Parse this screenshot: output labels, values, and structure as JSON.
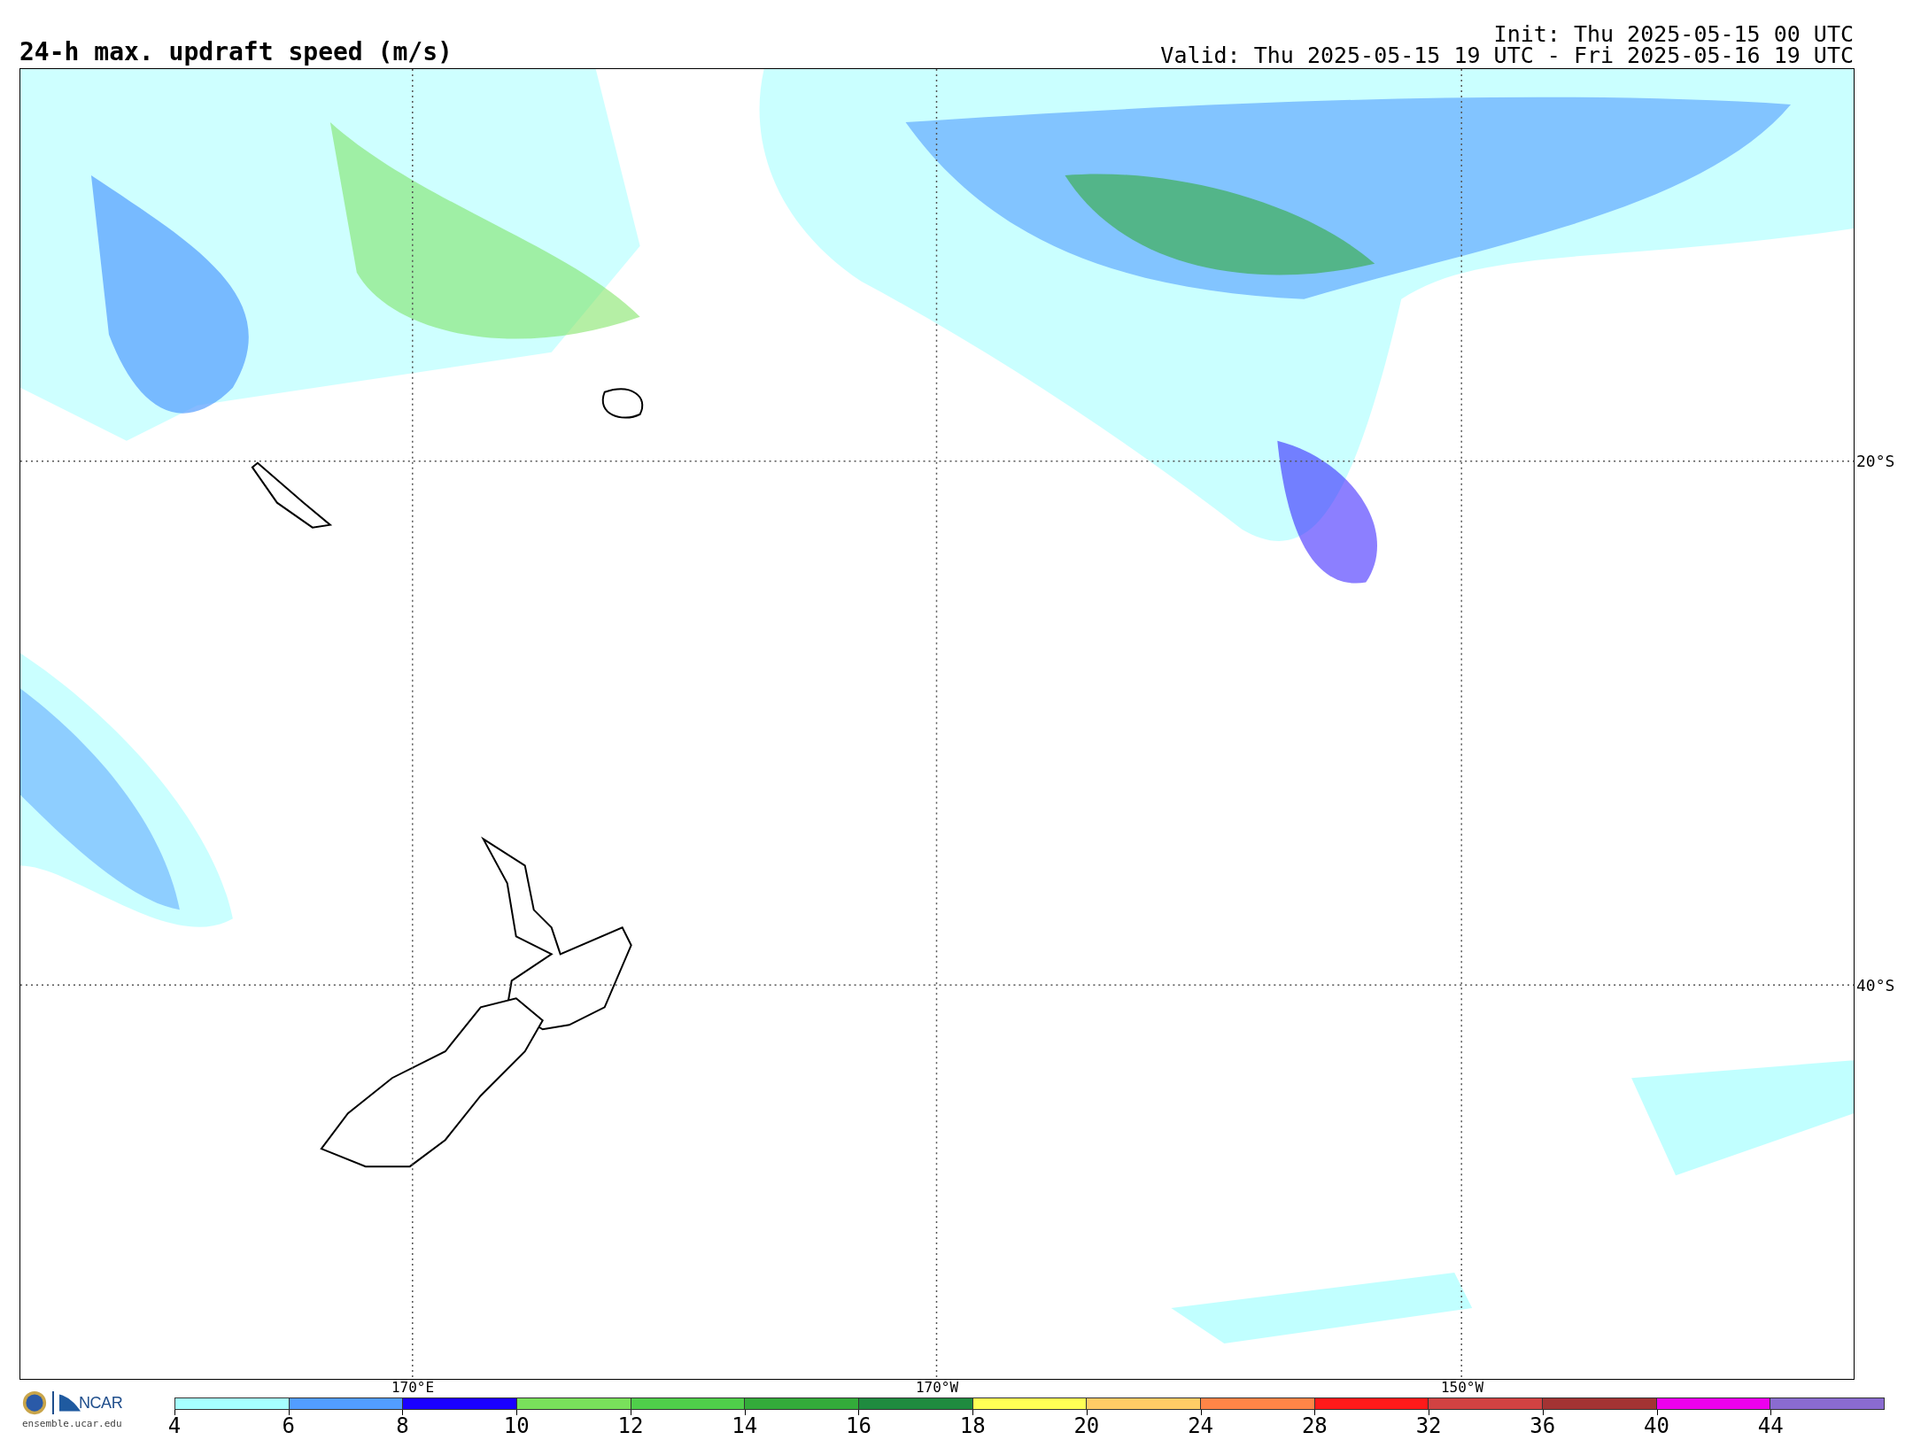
{
  "title": "24-h max. updraft speed (m/s)",
  "init": "Init: Thu 2025-05-15 00 UTC",
  "valid": "Valid: Thu 2025-05-15 19 UTC - Fri 2025-05-16 19 UTC",
  "map": {
    "lat_labels": [
      "20°S",
      "40°S"
    ],
    "lon_labels": [
      "170°E",
      "170°W",
      "150°W"
    ]
  },
  "legend": {
    "ticks": [
      "4",
      "6",
      "8",
      "10",
      "12",
      "14",
      "16",
      "18",
      "20",
      "24",
      "28",
      "32",
      "36",
      "40",
      "44"
    ],
    "items": [
      {
        "color": "#a6ffff"
      },
      {
        "color": "#529dff"
      },
      {
        "color": "#1a00ff"
      },
      {
        "color": "#79e15b"
      },
      {
        "color": "#4fcf4a"
      },
      {
        "color": "#33ab3a"
      },
      {
        "color": "#1f8b3f"
      },
      {
        "color": "#ffff55"
      },
      {
        "color": "#ffcc66"
      },
      {
        "color": "#ff8547"
      },
      {
        "color": "#ff1a1a"
      },
      {
        "color": "#d14242"
      },
      {
        "color": "#a33333"
      },
      {
        "color": "#ee00ee"
      },
      {
        "color": "#8a6bd0"
      }
    ]
  },
  "logo": {
    "org": "NCAR",
    "url": "ensemble.ucar.edu"
  }
}
